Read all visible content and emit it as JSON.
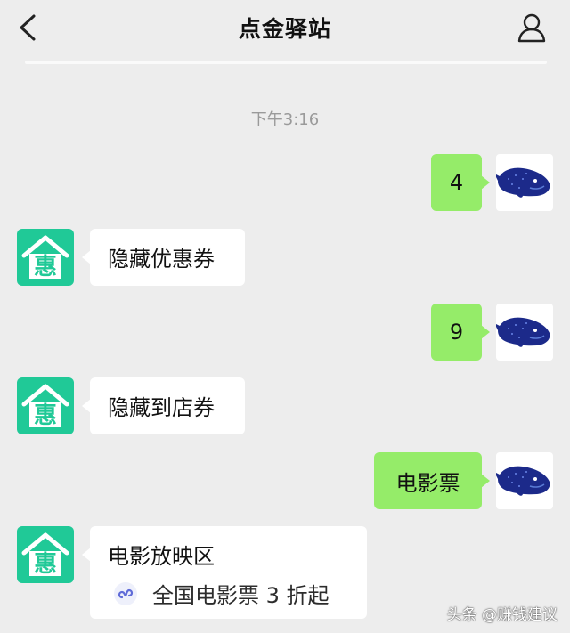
{
  "header": {
    "title": "点金驿站",
    "back_icon": "chevron-left-icon",
    "profile_icon": "person-icon"
  },
  "chat": {
    "timestamp": "下午3:16",
    "messages": [
      {
        "from": "me",
        "text": "4"
      },
      {
        "from": "bot",
        "text": "隐藏优惠券"
      },
      {
        "from": "me",
        "text": "9"
      },
      {
        "from": "bot",
        "text": "隐藏到店券"
      },
      {
        "from": "me",
        "text": "电影票"
      },
      {
        "from": "bot",
        "text": "电影放映区",
        "mini_program": "全国电影票 3 折起"
      }
    ]
  },
  "bot_avatar": {
    "glyph": "惠"
  },
  "watermark": "头条 @赚钱建议",
  "colors": {
    "background": "#ededed",
    "sent_bubble": "#95ec69",
    "received_bubble": "#ffffff",
    "bot_avatar": "#20c997"
  }
}
